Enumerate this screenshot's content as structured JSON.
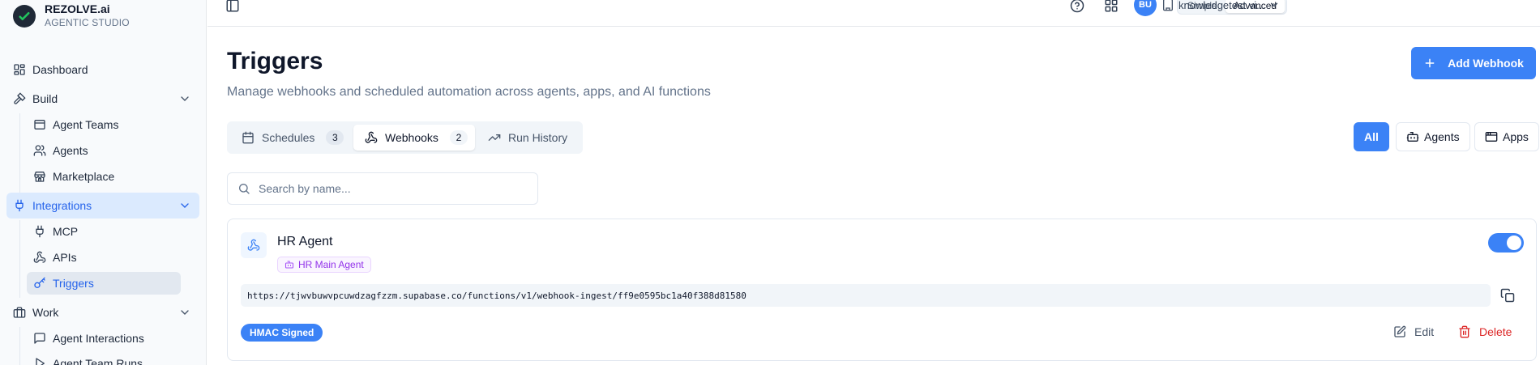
{
  "brand": {
    "name": "REZOLVE.ai",
    "subtitle": "AGENTIC STUDIO"
  },
  "sidebar": {
    "items": [
      {
        "label": "Dashboard",
        "icon": "dashboard-icon"
      },
      {
        "label": "Build",
        "icon": "hammer-icon",
        "expanded": true,
        "children": [
          {
            "label": "Agent Teams",
            "icon": "window-icon"
          },
          {
            "label": "Agents",
            "icon": "users-icon"
          },
          {
            "label": "Marketplace",
            "icon": "store-icon"
          }
        ]
      },
      {
        "label": "Integrations",
        "icon": "plug-icon",
        "expanded": true,
        "active": true,
        "children": [
          {
            "label": "MCP",
            "icon": "plug-icon"
          },
          {
            "label": "APIs",
            "icon": "webhook-icon"
          },
          {
            "label": "Triggers",
            "icon": "key-icon",
            "active": true
          }
        ]
      },
      {
        "label": "Work",
        "icon": "briefcase-icon",
        "expanded": true,
        "children": [
          {
            "label": "Agent Interactions",
            "icon": "message-icon"
          },
          {
            "label": "Agent Team Runs",
            "icon": "play-icon"
          }
        ]
      }
    ]
  },
  "topbar": {
    "modes": [
      "Simple",
      "Advanced"
    ],
    "active_mode": "Advanced",
    "avatar_initials": "BU",
    "workspace": "knowledgetest.vi..."
  },
  "page": {
    "title": "Triggers",
    "subtitle": "Manage webhooks and scheduled automation across agents, apps, and AI functions",
    "add_button": "Add Webhook"
  },
  "tabs": [
    {
      "label": "Schedules",
      "count": "3",
      "icon": "calendar-icon"
    },
    {
      "label": "Webhooks",
      "count": "2",
      "icon": "webhook-icon",
      "active": true
    },
    {
      "label": "Run History",
      "icon": "trending-icon"
    }
  ],
  "filters": [
    {
      "label": "All",
      "active": true
    },
    {
      "label": "Agents",
      "icon": "bot-icon"
    },
    {
      "label": "Apps",
      "icon": "app-window-icon"
    }
  ],
  "search": {
    "placeholder": "Search by name...",
    "value": ""
  },
  "webhooks": [
    {
      "name": "HR Agent",
      "agent": "HR Main Agent",
      "enabled": true,
      "url": "https://tjwvbuwvpcuwdzagfzzm.supabase.co/functions/v1/webhook-ingest/ff9e0595bc1a40f388d81580",
      "signature": "HMAC Signed",
      "edit_label": "Edit",
      "delete_label": "Delete"
    }
  ],
  "colors": {
    "accent": "#3b82f6",
    "danger": "#dc2626",
    "agent_badge": "#9333ea"
  }
}
